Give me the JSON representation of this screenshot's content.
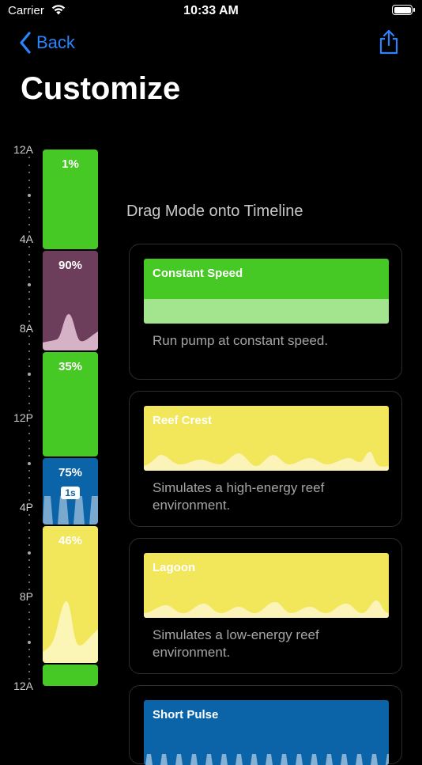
{
  "status_bar": {
    "carrier": "Carrier",
    "time": "10:33 AM"
  },
  "nav": {
    "back_label": "Back"
  },
  "page": {
    "title": "Customize"
  },
  "timeline": {
    "hour_labels": [
      "12A",
      "4A",
      "8A",
      "12P",
      "4P",
      "8P",
      "12A"
    ],
    "blocks": [
      {
        "percent": "1%",
        "color": "#46c924"
      },
      {
        "percent": "90%",
        "color": "#6d3d5c"
      },
      {
        "percent": "35%",
        "color": "#46c924"
      },
      {
        "percent": "75%",
        "badge": "1s",
        "color": "#0b63a8"
      },
      {
        "percent": "46%",
        "color": "#f2e65a"
      },
      {
        "percent": "",
        "color": "#46c924"
      }
    ]
  },
  "panel": {
    "heading": "Drag Mode onto Timeline",
    "modes": [
      {
        "name": "Constant Speed",
        "description": "Run pump at constant speed.",
        "color": "#46c924"
      },
      {
        "name": "Reef Crest",
        "description": "Simulates a high-energy reef environment.",
        "color": "#f2e65a"
      },
      {
        "name": "Lagoon",
        "description": "Simulates a low-energy reef environment.",
        "color": "#f2e65a"
      },
      {
        "name": "Short Pulse",
        "description": "",
        "color": "#0b63a8"
      }
    ]
  }
}
